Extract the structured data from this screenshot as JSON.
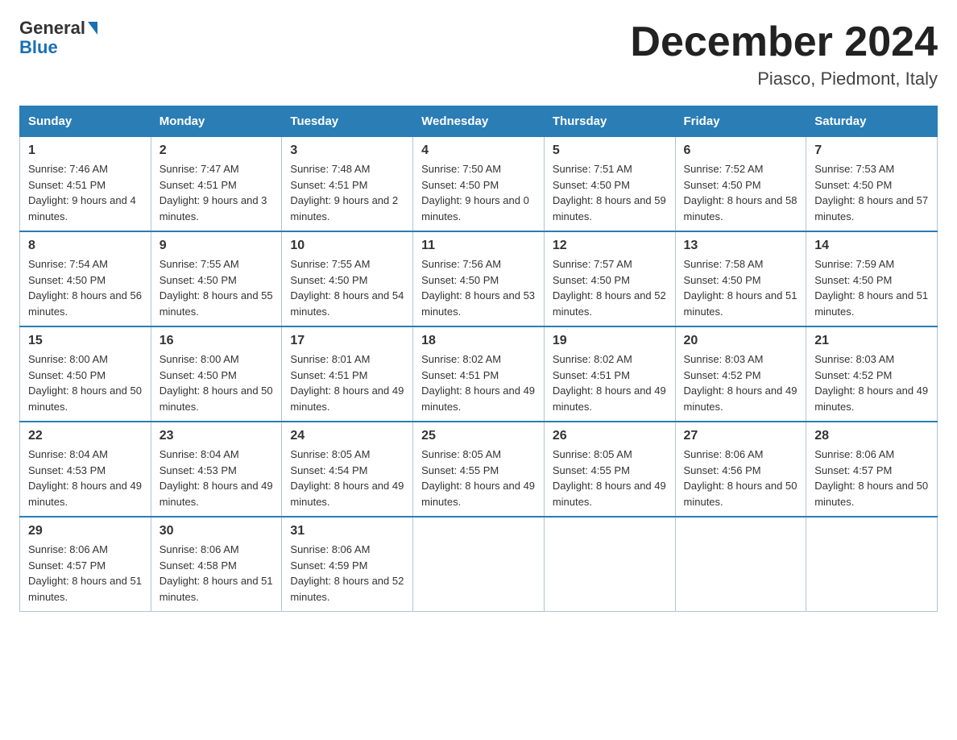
{
  "header": {
    "logo_general": "General",
    "logo_blue": "Blue",
    "month_title": "December 2024",
    "location": "Piasco, Piedmont, Italy"
  },
  "weekdays": [
    "Sunday",
    "Monday",
    "Tuesday",
    "Wednesday",
    "Thursday",
    "Friday",
    "Saturday"
  ],
  "weeks": [
    [
      {
        "day": "1",
        "sunrise": "7:46 AM",
        "sunset": "4:51 PM",
        "daylight": "9 hours and 4 minutes."
      },
      {
        "day": "2",
        "sunrise": "7:47 AM",
        "sunset": "4:51 PM",
        "daylight": "9 hours and 3 minutes."
      },
      {
        "day": "3",
        "sunrise": "7:48 AM",
        "sunset": "4:51 PM",
        "daylight": "9 hours and 2 minutes."
      },
      {
        "day": "4",
        "sunrise": "7:50 AM",
        "sunset": "4:50 PM",
        "daylight": "9 hours and 0 minutes."
      },
      {
        "day": "5",
        "sunrise": "7:51 AM",
        "sunset": "4:50 PM",
        "daylight": "8 hours and 59 minutes."
      },
      {
        "day": "6",
        "sunrise": "7:52 AM",
        "sunset": "4:50 PM",
        "daylight": "8 hours and 58 minutes."
      },
      {
        "day": "7",
        "sunrise": "7:53 AM",
        "sunset": "4:50 PM",
        "daylight": "8 hours and 57 minutes."
      }
    ],
    [
      {
        "day": "8",
        "sunrise": "7:54 AM",
        "sunset": "4:50 PM",
        "daylight": "8 hours and 56 minutes."
      },
      {
        "day": "9",
        "sunrise": "7:55 AM",
        "sunset": "4:50 PM",
        "daylight": "8 hours and 55 minutes."
      },
      {
        "day": "10",
        "sunrise": "7:55 AM",
        "sunset": "4:50 PM",
        "daylight": "8 hours and 54 minutes."
      },
      {
        "day": "11",
        "sunrise": "7:56 AM",
        "sunset": "4:50 PM",
        "daylight": "8 hours and 53 minutes."
      },
      {
        "day": "12",
        "sunrise": "7:57 AM",
        "sunset": "4:50 PM",
        "daylight": "8 hours and 52 minutes."
      },
      {
        "day": "13",
        "sunrise": "7:58 AM",
        "sunset": "4:50 PM",
        "daylight": "8 hours and 51 minutes."
      },
      {
        "day": "14",
        "sunrise": "7:59 AM",
        "sunset": "4:50 PM",
        "daylight": "8 hours and 51 minutes."
      }
    ],
    [
      {
        "day": "15",
        "sunrise": "8:00 AM",
        "sunset": "4:50 PM",
        "daylight": "8 hours and 50 minutes."
      },
      {
        "day": "16",
        "sunrise": "8:00 AM",
        "sunset": "4:50 PM",
        "daylight": "8 hours and 50 minutes."
      },
      {
        "day": "17",
        "sunrise": "8:01 AM",
        "sunset": "4:51 PM",
        "daylight": "8 hours and 49 minutes."
      },
      {
        "day": "18",
        "sunrise": "8:02 AM",
        "sunset": "4:51 PM",
        "daylight": "8 hours and 49 minutes."
      },
      {
        "day": "19",
        "sunrise": "8:02 AM",
        "sunset": "4:51 PM",
        "daylight": "8 hours and 49 minutes."
      },
      {
        "day": "20",
        "sunrise": "8:03 AM",
        "sunset": "4:52 PM",
        "daylight": "8 hours and 49 minutes."
      },
      {
        "day": "21",
        "sunrise": "8:03 AM",
        "sunset": "4:52 PM",
        "daylight": "8 hours and 49 minutes."
      }
    ],
    [
      {
        "day": "22",
        "sunrise": "8:04 AM",
        "sunset": "4:53 PM",
        "daylight": "8 hours and 49 minutes."
      },
      {
        "day": "23",
        "sunrise": "8:04 AM",
        "sunset": "4:53 PM",
        "daylight": "8 hours and 49 minutes."
      },
      {
        "day": "24",
        "sunrise": "8:05 AM",
        "sunset": "4:54 PM",
        "daylight": "8 hours and 49 minutes."
      },
      {
        "day": "25",
        "sunrise": "8:05 AM",
        "sunset": "4:55 PM",
        "daylight": "8 hours and 49 minutes."
      },
      {
        "day": "26",
        "sunrise": "8:05 AM",
        "sunset": "4:55 PM",
        "daylight": "8 hours and 49 minutes."
      },
      {
        "day": "27",
        "sunrise": "8:06 AM",
        "sunset": "4:56 PM",
        "daylight": "8 hours and 50 minutes."
      },
      {
        "day": "28",
        "sunrise": "8:06 AM",
        "sunset": "4:57 PM",
        "daylight": "8 hours and 50 minutes."
      }
    ],
    [
      {
        "day": "29",
        "sunrise": "8:06 AM",
        "sunset": "4:57 PM",
        "daylight": "8 hours and 51 minutes."
      },
      {
        "day": "30",
        "sunrise": "8:06 AM",
        "sunset": "4:58 PM",
        "daylight": "8 hours and 51 minutes."
      },
      {
        "day": "31",
        "sunrise": "8:06 AM",
        "sunset": "4:59 PM",
        "daylight": "8 hours and 52 minutes."
      },
      null,
      null,
      null,
      null
    ]
  ]
}
